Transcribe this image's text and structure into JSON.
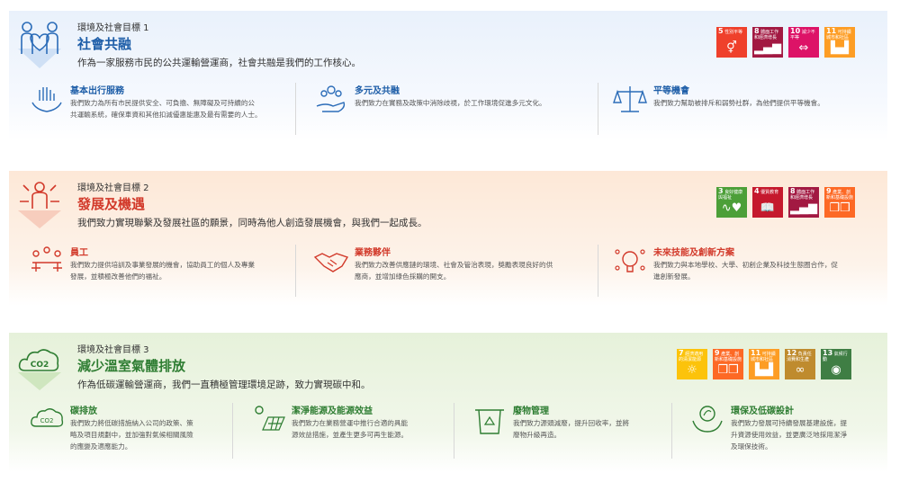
{
  "goal1": {
    "tag": "環境及社會目標 1",
    "title": "社會共融",
    "desc": "作為一家服務市民的公共運輸營運商，社會共融是我們的工作核心。",
    "sdgs": [
      {
        "num": "5",
        "label": "性別平等",
        "color": "#ef402b",
        "glyph": "⚥"
      },
      {
        "num": "8",
        "label": "體面工作和經濟增長",
        "color": "#a21942",
        "glyph": "▂▄▆"
      },
      {
        "num": "10",
        "label": "減少不平等",
        "color": "#dd1367",
        "glyph": "⇔"
      },
      {
        "num": "11",
        "label": "可持續城市和社區",
        "color": "#fd9d24",
        "glyph": "▙▟"
      }
    ],
    "items": [
      {
        "title": "基本出行服務",
        "text": [
          "我們致力為所有市民提供安全、可負擔、無障礙及可持續的公",
          "共運輸系統，確保車資和其他扣減優惠能惠及最有需要的人士。"
        ]
      },
      {
        "title": "多元及共融",
        "text": [
          "我們致力在實務及政策中消除歧視，於工作環境促進多元文化。"
        ]
      },
      {
        "title": "平等機會",
        "text": [
          "我們致力幫助被排斥和弱勢社群，為他們提供平等機會。"
        ]
      }
    ]
  },
  "goal2": {
    "tag": "環境及社會目標 2",
    "title": "發展及機遇",
    "desc": "我們致力實現聯繫及發展社區的願景，同時為他人創造發展機會，與我們一起成長。",
    "sdgs": [
      {
        "num": "3",
        "label": "良好健康與福祉",
        "color": "#4c9f38",
        "glyph": "∿♥"
      },
      {
        "num": "4",
        "label": "優質教育",
        "color": "#c5192d",
        "glyph": "📖"
      },
      {
        "num": "8",
        "label": "體面工作和經濟增長",
        "color": "#a21942",
        "glyph": "▂▄▆"
      },
      {
        "num": "9",
        "label": "產業、創新和基礎設施",
        "color": "#fd6925",
        "glyph": "❒❒"
      }
    ],
    "items": [
      {
        "title": "員工",
        "text": [
          "我們致力提供培訓及事業發展的機會，協助員工的個人及專業",
          "發展，並積極改善他們的福祉。"
        ]
      },
      {
        "title": "業務夥伴",
        "text": [
          "我們致力改善供應鏈的環境、社會及管治表現，獎勵表現良好的供",
          "應商，並增加綠色採購的開支。"
        ]
      },
      {
        "title": "未來技能及創新方案",
        "text": [
          "我們致力與本地學校、大學、初創企業及科技生態圈合作，促",
          "進創新發展。"
        ]
      }
    ]
  },
  "goal3": {
    "tag": "環境及社會目標 3",
    "title": "減少溫室氣體排放",
    "desc": "作為低碳運輸營運商，我們一直積極管理環境足跡，致力實現碳中和。",
    "sdgs": [
      {
        "num": "7",
        "label": "經濟適用的清潔能源",
        "color": "#fcc30b",
        "glyph": "☼"
      },
      {
        "num": "9",
        "label": "產業、創新和基礎設施",
        "color": "#fd6925",
        "glyph": "❒❒"
      },
      {
        "num": "11",
        "label": "可持續城市和社區",
        "color": "#fd9d24",
        "glyph": "▙▟"
      },
      {
        "num": "12",
        "label": "負責任消費和生產",
        "color": "#bf8b2e",
        "glyph": "∞"
      },
      {
        "num": "13",
        "label": "氣候行動",
        "color": "#3f7e44",
        "glyph": "◉"
      }
    ],
    "items": [
      {
        "title": "碳排放",
        "text": [
          "我們致力將低碳措施納入公司的政策、策",
          "略及項目規劃中，並加強對氣候相關風險",
          "的應變及適應能力。"
        ]
      },
      {
        "title": "潔淨能源及能源效益",
        "text": [
          "我們致力在業務營運中推行合適的具能",
          "源效益措施，並產生更多可再生能源。"
        ]
      },
      {
        "title": "廢物管理",
        "text": [
          "我們致力源頭減廢，提升回收率，並將",
          "廢物升級再造。"
        ]
      },
      {
        "title": "環保及低碳設計",
        "text": [
          "我們致力發展可持續發展基建設施，提",
          "升資源使用效益，並更廣泛地採用潔淨",
          "及環保技術。"
        ]
      }
    ]
  }
}
